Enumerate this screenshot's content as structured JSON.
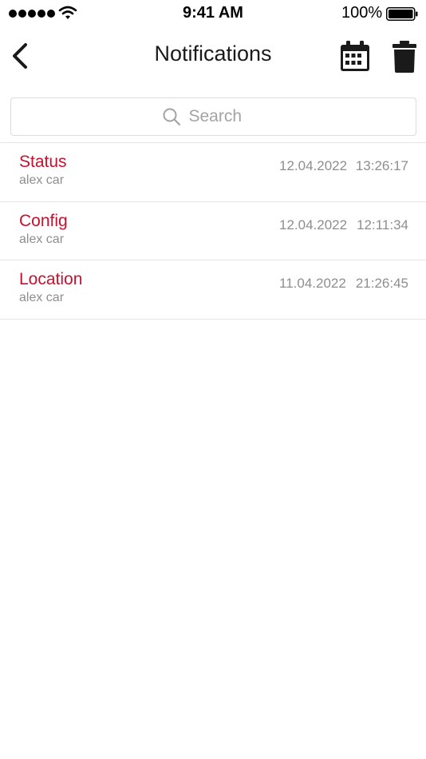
{
  "status_bar": {
    "time": "9:41 AM",
    "battery_percent": "100%",
    "signal_icon": "signal-dots-icon",
    "wifi_icon": "wifi-icon",
    "battery_icon": "battery-full-icon"
  },
  "nav": {
    "title": "Notifications",
    "back_icon": "chevron-left-icon",
    "calendar_icon": "calendar-icon",
    "trash_icon": "trash-icon"
  },
  "search": {
    "placeholder": "Search",
    "value": "",
    "icon": "search-icon"
  },
  "notifications": [
    {
      "title": "Status",
      "subtitle": "alex car",
      "date": "12.04.2022",
      "time": "13:26:17"
    },
    {
      "title": "Config",
      "subtitle": "alex car",
      "date": "12.04.2022",
      "time": "12:11:34"
    },
    {
      "title": "Location",
      "subtitle": "alex car",
      "date": "11.04.2022",
      "time": "21:26:45"
    }
  ],
  "colors": {
    "accent": "#c8102e",
    "secondary_text": "#8e8e8e",
    "divider": "#e6e6e6"
  }
}
